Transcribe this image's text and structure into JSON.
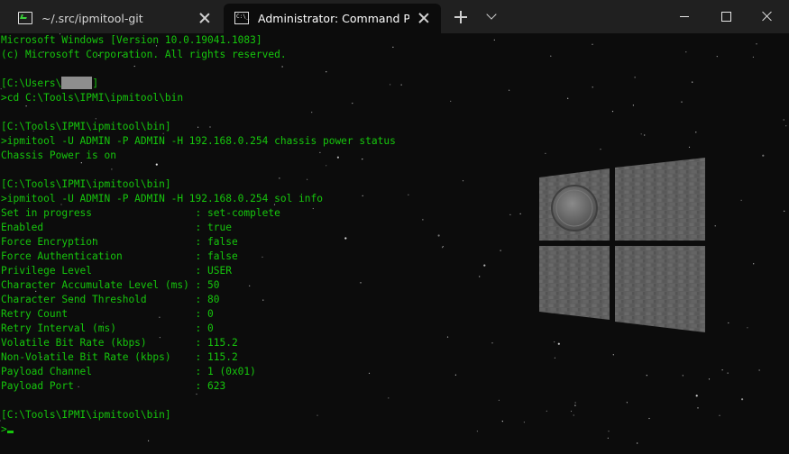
{
  "tabs": [
    {
      "title": "~/.src/ipmitool-git",
      "icon": "git-bash-icon",
      "active": false
    },
    {
      "title": "Administrator: Command Prompt",
      "icon": "cmd-icon",
      "active": true
    }
  ],
  "cmd_icon_text": "C:\\_",
  "terminal": {
    "text_color": "#16c60c",
    "lines": [
      "Microsoft Windows [Version 10.0.19041.1083]",
      "(c) Microsoft Corporation. All rights reserved.",
      "",
      "[C:\\Users\\",
      ">cd C:\\Tools\\IPMI\\ipmitool\\bin",
      "",
      "[C:\\Tools\\IPMI\\ipmitool\\bin]",
      ">ipmitool -U ADMIN -P ADMIN -H 192.168.0.254 chassis power status",
      "Chassis Power is on",
      "",
      "[C:\\Tools\\IPMI\\ipmitool\\bin]",
      ">ipmitool -U ADMIN -P ADMIN -H 192.168.0.254 sol info",
      "Set in progress                 : set-complete",
      "Enabled                         : true",
      "Force Encryption                : false",
      "Force Authentication            : false",
      "Privilege Level                 : USER",
      "Character Accumulate Level (ms) : 50",
      "Character Send Threshold        : 80",
      "Retry Count                     : 0",
      "Retry Interval (ms)             : 0",
      "Volatile Bit Rate (kbps)        : 115.2",
      "Non-Volatile Bit Rate (kbps)    : 115.2",
      "Payload Channel                 : 1 (0x01)",
      "Payload Port                    : 623",
      "",
      "[C:\\Tools\\IPMI\\ipmitool\\bin]",
      ">"
    ],
    "redacted_line_suffix": "]"
  }
}
